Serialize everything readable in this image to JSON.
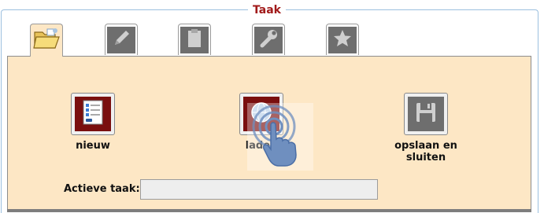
{
  "section": {
    "title": "Taak"
  },
  "tabs": [
    {
      "icon": "folder-open-icon",
      "active": true
    },
    {
      "icon": "pencil-icon",
      "active": false
    },
    {
      "icon": "clipboard-icon",
      "active": false
    },
    {
      "icon": "wrench-icon",
      "active": false
    },
    {
      "icon": "star-icon",
      "active": false
    }
  ],
  "actions": {
    "new": {
      "label": "nieuw",
      "icon": "new-task-document-icon"
    },
    "load": {
      "label": "laden",
      "icon": "load-globe-icon"
    },
    "save": {
      "label": "opslaan en sluiten",
      "icon": "floppy-disk-icon"
    }
  },
  "active_task": {
    "label": "Actieve taak:",
    "value": ""
  },
  "colors": {
    "accent": "#a11a1a",
    "panel": "#fde7c5",
    "button_dark_red": "#7a0f0f",
    "tab_gray": "#6e6e6e",
    "frame_border": "#9cc0df"
  }
}
